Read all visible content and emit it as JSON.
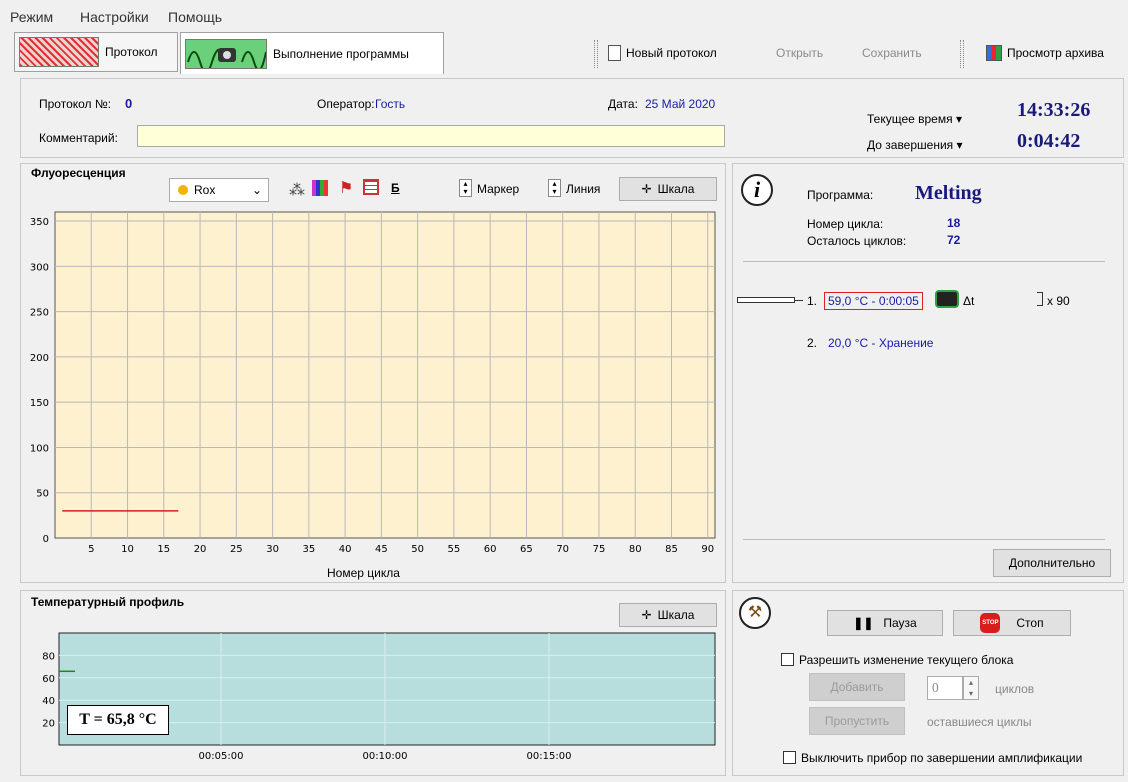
{
  "menu": [
    "Режим",
    "Настройки",
    "Помощь"
  ],
  "tabs": [
    {
      "label": "Протокол"
    },
    {
      "label": "Выполнение программы"
    }
  ],
  "toolbar": {
    "new_protocol": "Новый протокол",
    "open": "Открыть",
    "save": "Сохранить",
    "archive": "Просмотр архива"
  },
  "header": {
    "protocol_label": "Протокол №:",
    "protocol_value": "0",
    "operator_label": "Оператор:",
    "operator_value": "Гость",
    "date_label": "Дата:",
    "date_value": "25 Май 2020",
    "comment_label": "Комментарий:",
    "comment_value": "",
    "current_time_label": "Текущее время",
    "current_time_value": "14:33:26",
    "remaining_label": "До завершения",
    "remaining_value": "0:04:42"
  },
  "fluorescence": {
    "title": "Флуоресценция",
    "channel": "Rox",
    "b_label": "Б",
    "marker_label": "Маркер",
    "line_label": "Линия",
    "scale_label": "Шкала",
    "xlabel": "Номер цикла",
    "yticks": [
      "350",
      "300",
      "250",
      "200",
      "150",
      "100",
      "50",
      "0"
    ],
    "xticks": [
      "5",
      "10",
      "15",
      "20",
      "25",
      "30",
      "35",
      "40",
      "45",
      "50",
      "55",
      "60",
      "65",
      "70",
      "75",
      "80",
      "85",
      "90"
    ]
  },
  "chart_data": {
    "type": "line",
    "title": "Флуоресценция",
    "xlabel": "Номер цикла",
    "ylabel": "",
    "xlim": [
      0,
      91
    ],
    "ylim": [
      0,
      360
    ],
    "series": [
      {
        "name": "Rox",
        "x": [
          1,
          17
        ],
        "y": [
          30,
          30
        ],
        "color": "#d02020"
      }
    ]
  },
  "info": {
    "program_label": "Программа:",
    "program_value": "Melting",
    "cycle_label": "Номер цикла:",
    "cycle_value": "18",
    "remaining_label": "Осталось циклов:",
    "remaining_value": "72",
    "step1_num": "1.",
    "step1": "59,0 °C  -  0:00:05",
    "step1_delta": "Δt",
    "step1_repeat": "x 90",
    "step2_num": "2.",
    "step2": "20,0 °C  -  Хранение",
    "more_button": "Дополнительно"
  },
  "temperature": {
    "title": "Температурный профиль",
    "scale_label": "Шкала",
    "yticks": [
      "80",
      "60",
      "40",
      "20"
    ],
    "xticks": [
      "00:05:00",
      "00:10:00",
      "00:15:00"
    ],
    "t_readout": "T = 65,8 °C"
  },
  "controls": {
    "pause": "Пауза",
    "stop": "Стоп",
    "stop_badge": "STOP",
    "allow_change": "Разрешить изменение текущего блока",
    "add": "Добавить",
    "cycles_value": "0",
    "cycles_label": "циклов",
    "skip": "Пропустить",
    "remaining_cycles": "оставшиеся циклы",
    "poweroff": "Выключить прибор по завершении амплификации"
  },
  "colors": {
    "chart_bg": "#fdf1cf",
    "temp_bg": "#b7dedd",
    "accent": "#1a1aa8"
  }
}
